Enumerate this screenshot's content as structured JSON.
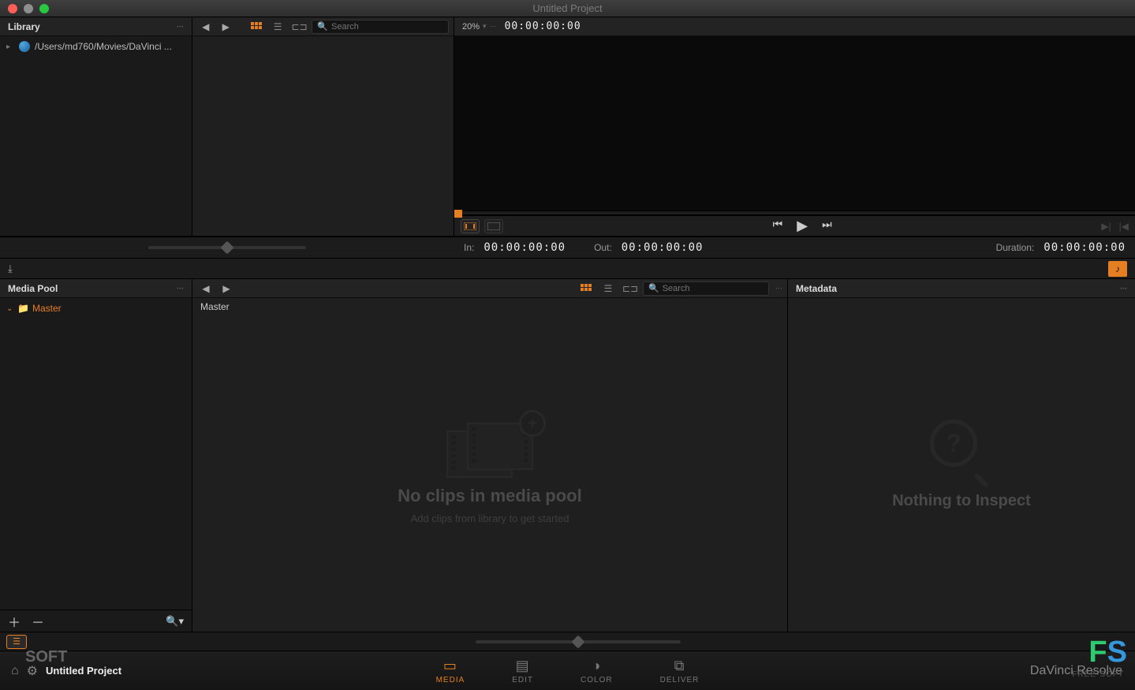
{
  "window": {
    "title": "Untitled Project"
  },
  "library": {
    "header": "Library",
    "items": [
      {
        "path": "/Users/md760/Movies/DaVinci ..."
      }
    ]
  },
  "browser": {
    "search_placeholder": "Search"
  },
  "viewer": {
    "zoom": "20%",
    "timecode": "00:00:00:00",
    "in_label": "In:",
    "in_tc": "00:00:00:00",
    "out_label": "Out:",
    "out_tc": "00:00:00:00",
    "dur_label": "Duration:",
    "dur_tc": "00:00:00:00"
  },
  "media_pool": {
    "header": "Media Pool",
    "root_bin": "Master",
    "current_bin": "Master",
    "search_placeholder": "Search",
    "empty_heading": "No clips in media pool",
    "empty_sub": "Add clips from library to get started"
  },
  "metadata": {
    "header": "Metadata",
    "empty_heading": "Nothing to Inspect"
  },
  "pages": {
    "project": "Untitled Project",
    "tabs": {
      "media": "MEDIA",
      "edit": "EDIT",
      "color": "COLOR",
      "deliver": "DELIVER"
    }
  },
  "branding": {
    "app_name": "DaVinci Resolve",
    "wm_soft": "SOFT",
    "wm_free": "FREE-SOFT"
  }
}
